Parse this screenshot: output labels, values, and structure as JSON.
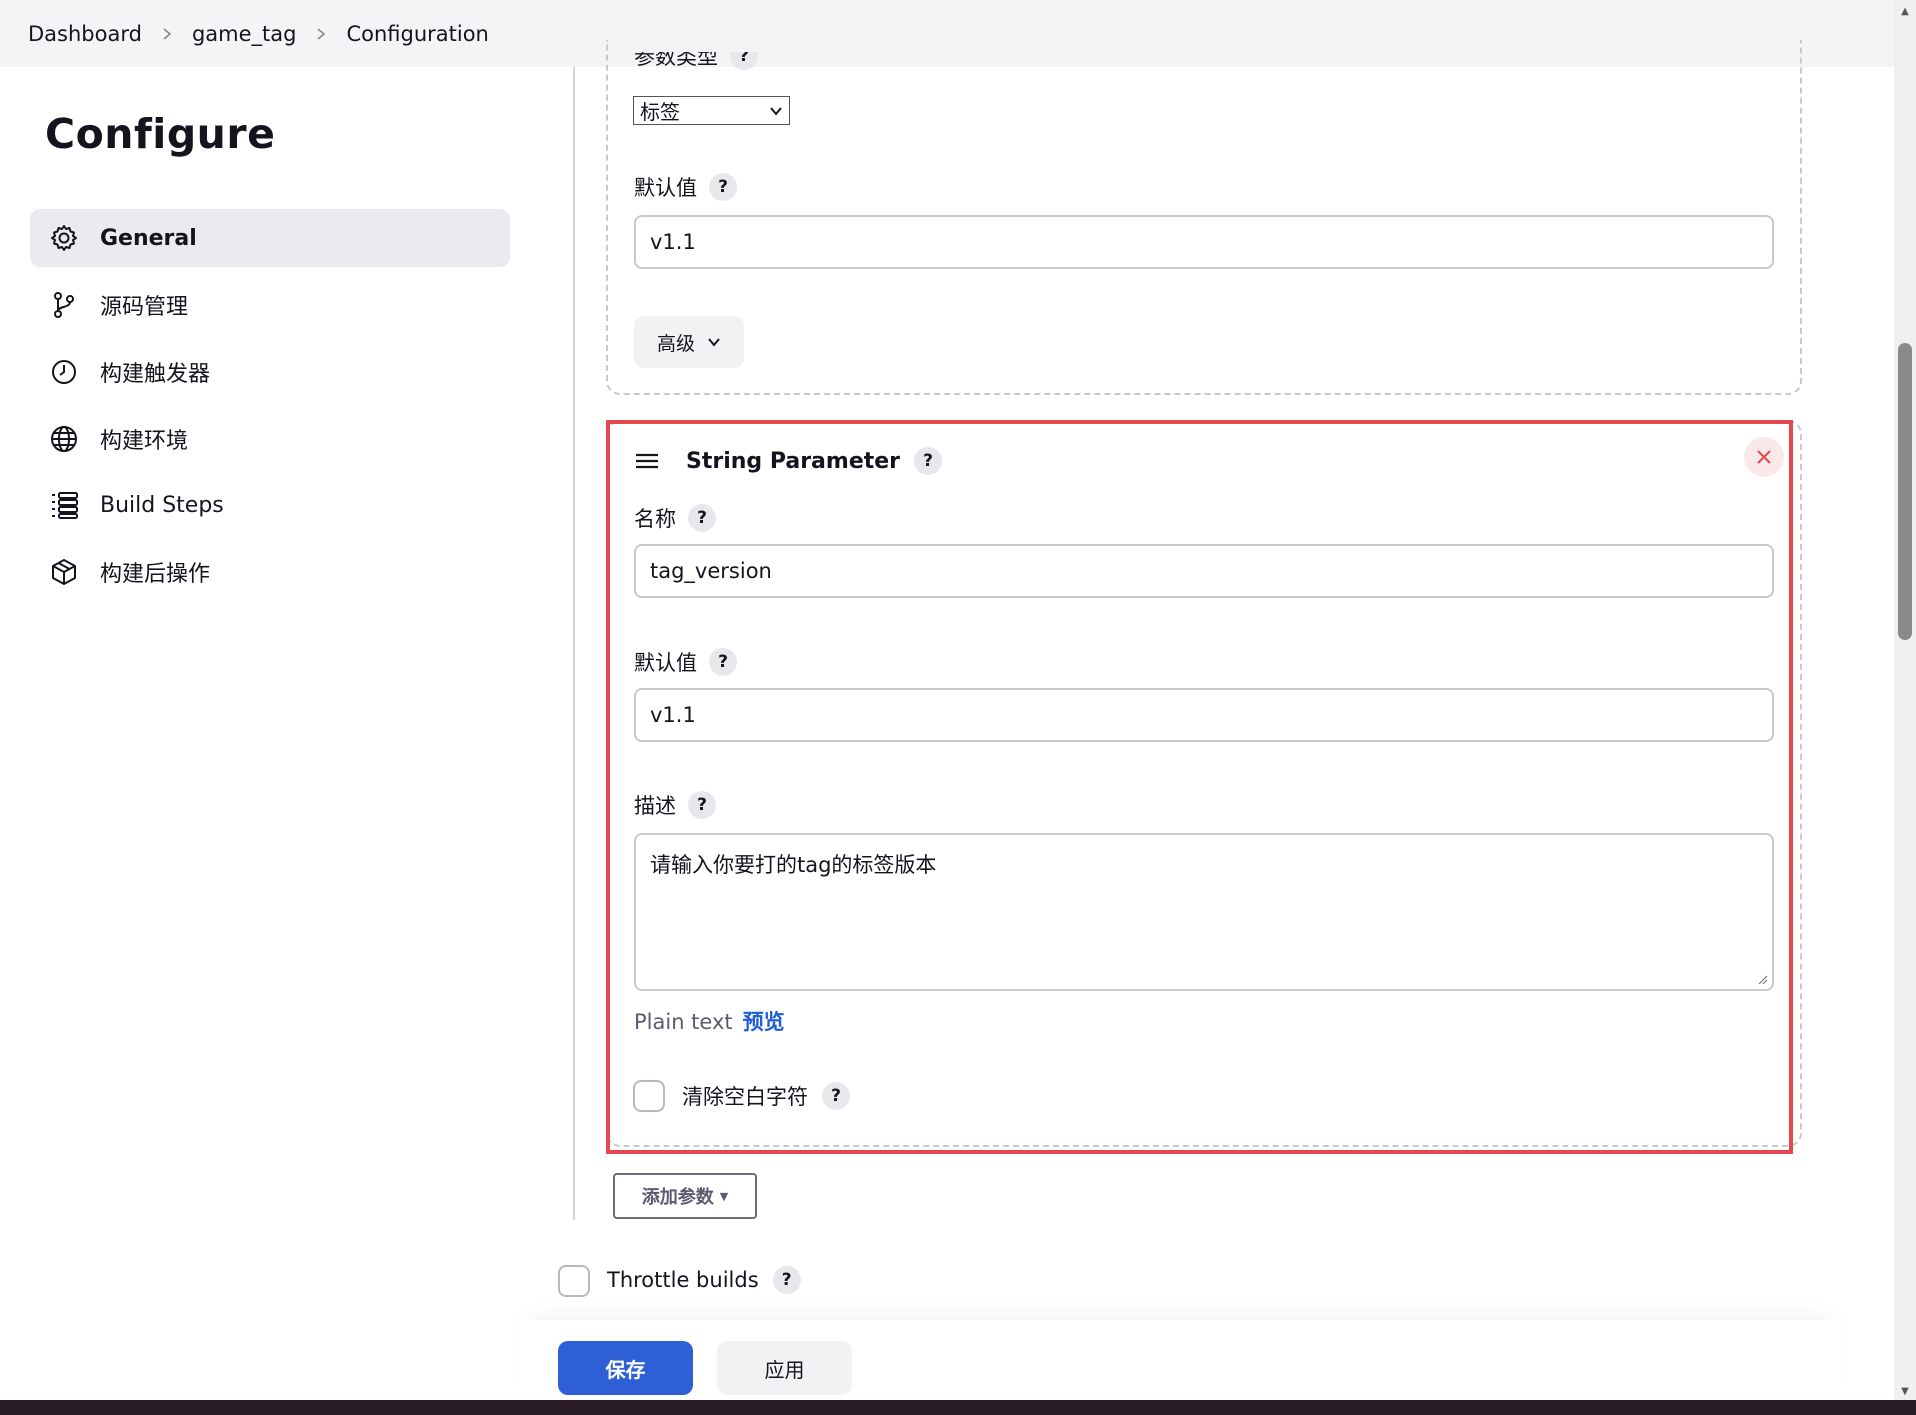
{
  "breadcrumb": {
    "items": [
      "Dashboard",
      "game_tag",
      "Configuration"
    ]
  },
  "sidebar": {
    "title": "Configure",
    "items": [
      {
        "label": "General",
        "icon": "gear-icon",
        "active": true
      },
      {
        "label": "源码管理",
        "icon": "branch-icon"
      },
      {
        "label": "构建触发器",
        "icon": "clock-icon"
      },
      {
        "label": "构建环境",
        "icon": "globe-icon"
      },
      {
        "label": "Build Steps",
        "icon": "list-icon"
      },
      {
        "label": "构建后操作",
        "icon": "package-icon"
      }
    ]
  },
  "param_top": {
    "type_label": "参数类型",
    "type_value": "标签",
    "default_label": "默认值",
    "default_value": "v1.1",
    "advanced_label": "高级"
  },
  "string_param": {
    "title": "String Parameter",
    "name_label": "名称",
    "name_value": "tag_version",
    "default_label": "默认值",
    "default_value": "v1.1",
    "desc_label": "描述",
    "desc_value": "请输入你要打的tag的标签版本",
    "plain_text": "Plain text",
    "preview": "预览",
    "trim_label": "清除空白字符"
  },
  "help_glyph": "?",
  "add_param_label": "添加参数",
  "throttle_label": "Throttle builds",
  "footer": {
    "save_label": "保存",
    "apply_label": "应用"
  },
  "colors": {
    "accent": "#2f5fd5",
    "highlight": "#e5484d",
    "close_icon": "#e5484d"
  }
}
